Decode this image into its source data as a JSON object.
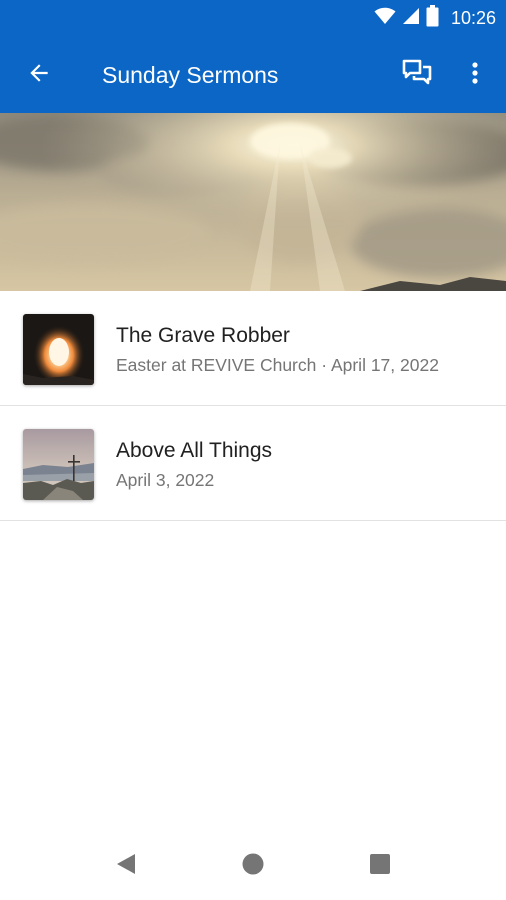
{
  "status_bar": {
    "time": "10:26",
    "icons": [
      "wifi-icon",
      "cell-signal-icon",
      "battery-icon"
    ]
  },
  "app_bar": {
    "title": "Sunday Sermons",
    "icons": [
      "back-arrow-icon",
      "chat-icon",
      "more-vert-icon"
    ]
  },
  "sermons": [
    {
      "title": "The Grave Robber",
      "subtitle": "Easter at REVIVE Church · April 17, 2022",
      "thumbnail": "empty-tomb-light"
    },
    {
      "title": "Above All Things",
      "subtitle": "April 3, 2022",
      "thumbnail": "mountain-cross"
    }
  ],
  "nav_bar": {
    "icons": [
      "back-triangle-icon",
      "home-circle-icon",
      "recents-square-icon"
    ]
  },
  "colors": {
    "primary": "#0b66c6",
    "title_text": "#212121",
    "subtitle_text": "#757575",
    "divider": "#e2e2e2"
  }
}
